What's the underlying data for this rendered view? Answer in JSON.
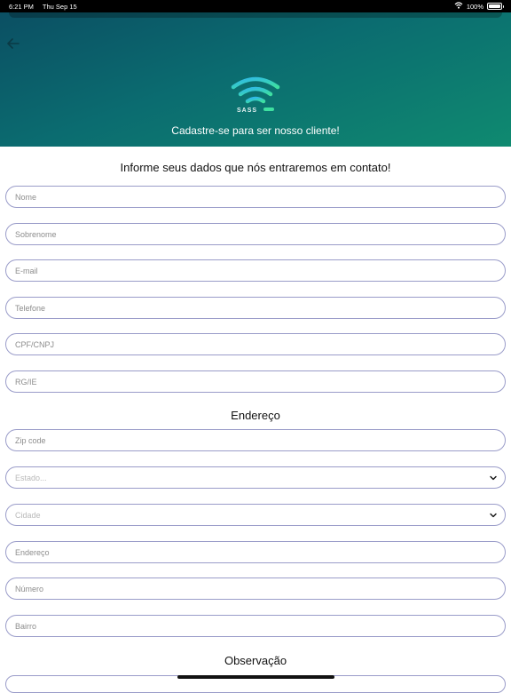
{
  "status_bar": {
    "time": "6:21 PM",
    "date": "Thu Sep 15",
    "battery": "100%"
  },
  "header": {
    "tagline": "Cadastre-se para ser nosso cliente!",
    "logo_text": "SASS",
    "colors": {
      "gradient_start": "#0b4f63",
      "gradient_end": "#0f8a70"
    }
  },
  "form": {
    "title": "Informe seus dados que nós entraremos em contato!",
    "fields": {
      "nome": "Nome",
      "sobrenome": "Sobrenome",
      "email": "E-mail",
      "telefone": "Telefone",
      "cpf": "CPF/CNPJ",
      "rg": "RG/IE"
    },
    "address_title": "Endereço",
    "address": {
      "zip": "Zip code",
      "estado": "Estado...",
      "cidade": "Cidade",
      "endereco": "Endereço",
      "numero": "Número",
      "bairro": "Bairro"
    },
    "notes_title": "Observação"
  }
}
